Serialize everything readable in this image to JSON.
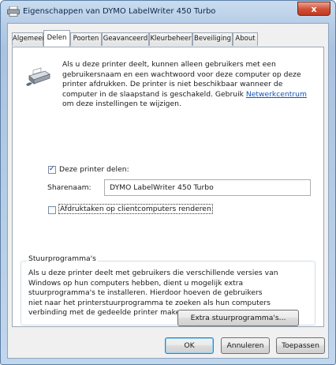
{
  "window": {
    "title": "Eigenschappen van DYMO LabelWriter 450 Turbo",
    "close_label": "x"
  },
  "tabs": [
    {
      "label": "Algemeen",
      "active": false
    },
    {
      "label": "Delen",
      "active": true
    },
    {
      "label": "Poorten",
      "active": false
    },
    {
      "label": "Geavanceerd",
      "active": false
    },
    {
      "label": "Kleurbeheer",
      "active": false
    },
    {
      "label": "Beveiliging",
      "active": false
    },
    {
      "label": "About",
      "active": false
    }
  ],
  "intro": {
    "line1": "Als u deze printer deelt, kunnen alleen gebruikers met een",
    "line2": "gebruikersnaam en een wachtwoord voor deze computer op deze",
    "line3": "printer afdrukken. De printer is niet beschikbaar wanneer de",
    "line4_prefix": "computer in de slaapstand is geschakeld. Gebruik ",
    "link_text": "Netwerkcentrum",
    "line5": "om deze instellingen te wijzigen."
  },
  "share": {
    "checkbox_label": "Deze printer delen:",
    "checked": true,
    "sharename_label": "Sharenaam:",
    "sharename_value": "DYMO LabelWriter 450 Turbo"
  },
  "render": {
    "checkbox_label": "Afdruktaken op clientcomputers renderen",
    "checked": false
  },
  "drivers": {
    "group_title": "Stuurprogramma's",
    "line1": "Als u deze printer deelt met gebruikers die verschillende versies van",
    "line2": "Windows op hun computers hebben, dient u mogelijk extra",
    "line3": "stuurprogramma's te installeren. Hierdoor hoeven de gebruikers",
    "line4": "niet naar het printerstuurprogramma te zoeken als hun computers",
    "line5": "verbinding met de gedeelde printer maken.",
    "extra_button": "Extra stuurprogramma's..."
  },
  "footer": {
    "ok": "OK",
    "cancel": "Annuleren",
    "apply": "Toepassen"
  },
  "colors": {
    "link": "#1455b6",
    "close_button": "#c23b22"
  }
}
